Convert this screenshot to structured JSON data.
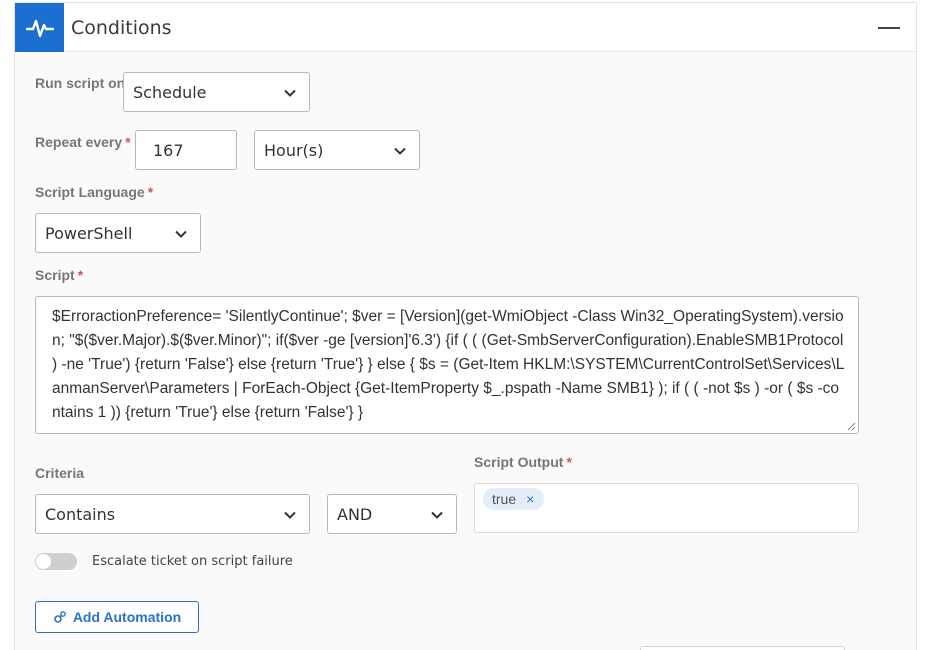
{
  "header": {
    "title": "Conditions",
    "icon": "pulse-icon",
    "accent": "#1b6fd1"
  },
  "run_script_on": {
    "label": "Run script on",
    "value": "Schedule"
  },
  "repeat_every": {
    "label": "Repeat every",
    "required": "*",
    "value": "167",
    "unit": "Hour(s)"
  },
  "script_language": {
    "label": "Script Language",
    "required": "*",
    "value": "PowerShell"
  },
  "script": {
    "label": "Script",
    "required": "*",
    "value": "$ErroractionPreference= 'SilentlyContinue';  $ver = [Version](get-WmiObject -Class Win32_OperatingSystem).version; \"$($ver.Major).$($ver.Minor)\"; if($ver -ge [version]'6.3') {if ( ( (Get-SmbServerConfiguration).EnableSMB1Protocol )  -ne 'True') {return 'False'} else {return 'True'} } else { $s =  (Get-Item HKLM:\\SYSTEM\\CurrentControlSet\\Services\\LanmanServer\\Parameters | ForEach-Object {Get-ItemProperty $_.pspath -Name SMB1} );  if ( ( -not $s ) -or ( $s -contains 1 )) {return 'True'} else {return 'False'} }"
  },
  "criteria": {
    "label": "Criteria",
    "value": "Contains",
    "operator": "AND"
  },
  "script_output": {
    "label": "Script Output",
    "required": "*",
    "tags": [
      "true"
    ],
    "remove_icon": "×"
  },
  "escalate": {
    "label": "Escalate ticket on script failure",
    "enabled": false
  },
  "add_automation": {
    "label": "Add Automation",
    "icon": "gear-link-icon"
  }
}
